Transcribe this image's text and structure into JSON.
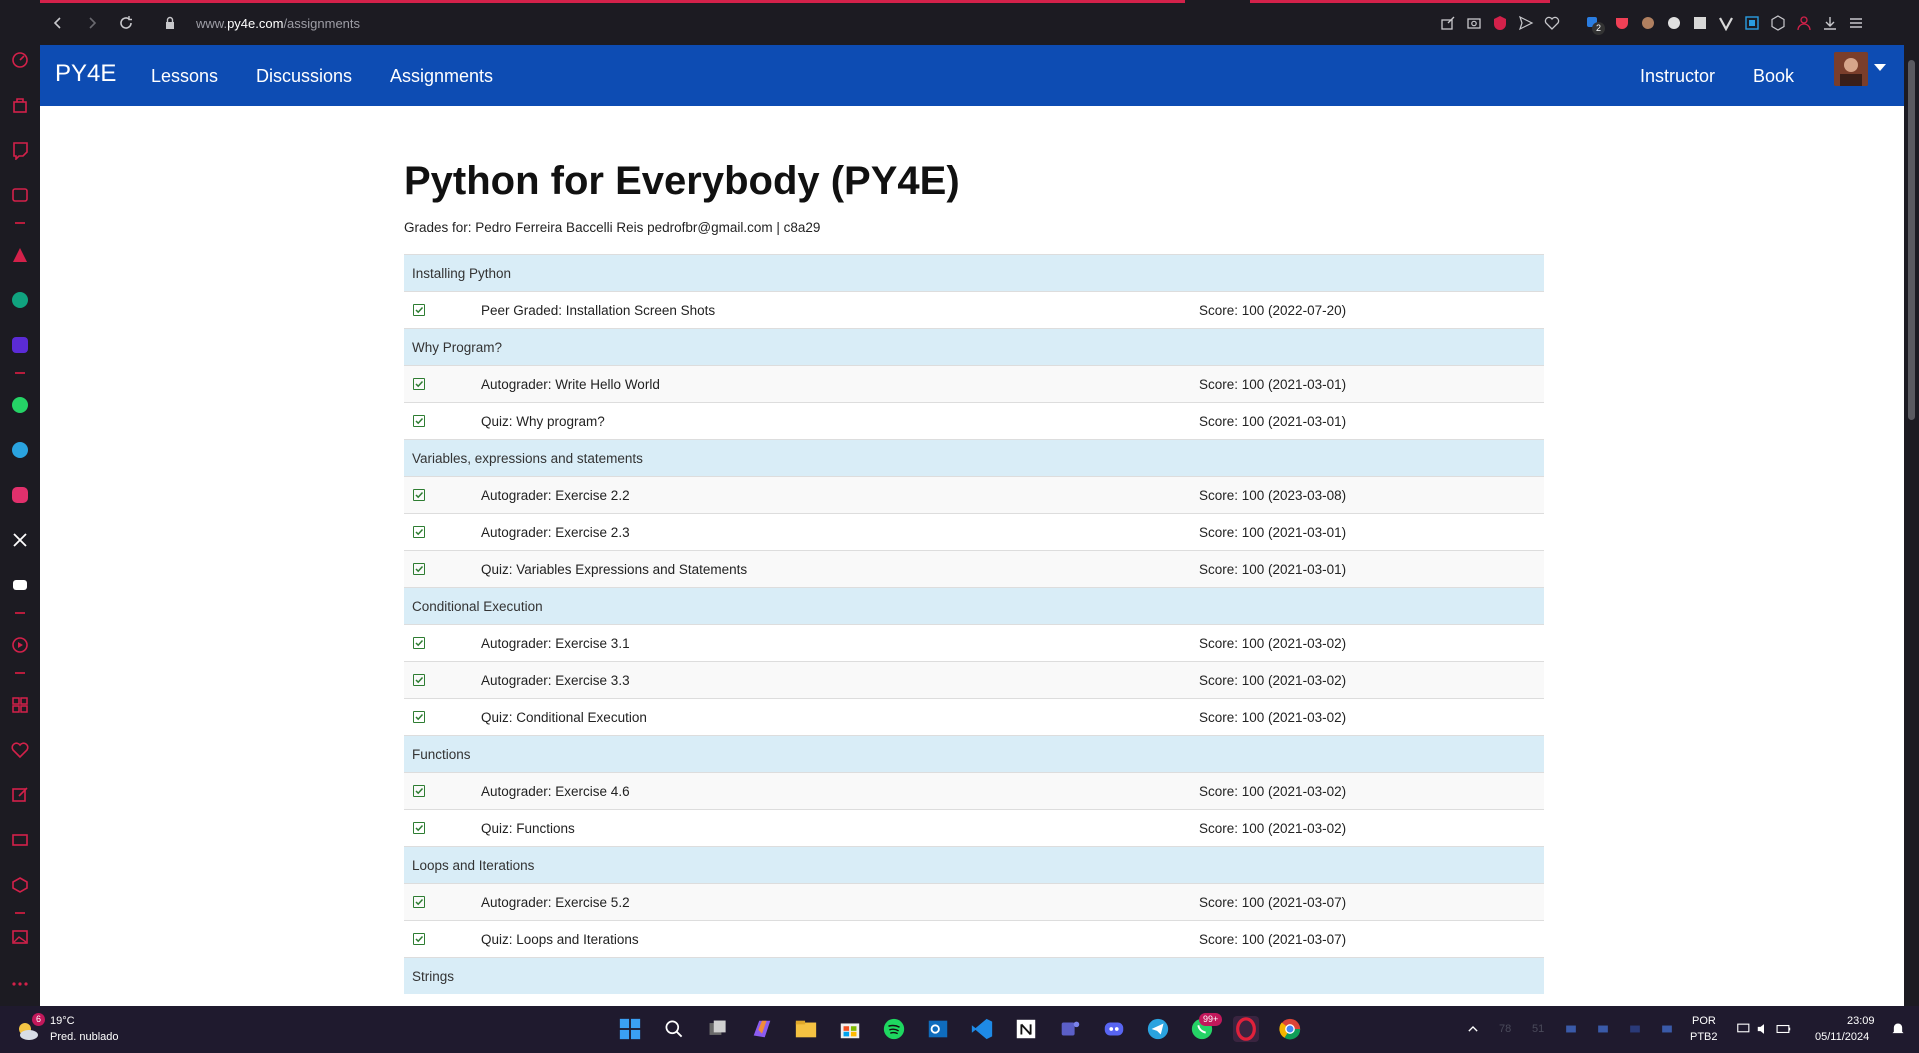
{
  "browser": {
    "url_prefix": "www.",
    "url_domain": "py4e.com",
    "url_path": "/assignments",
    "extension_badge": "2"
  },
  "site": {
    "brand": "PY4E",
    "nav_left": [
      "Lessons",
      "Discussions",
      "Assignments"
    ],
    "nav_right": [
      "Instructor",
      "Book"
    ]
  },
  "page": {
    "title": "Python for Everybody (PY4E)",
    "grades_for": "Grades for: Pedro Ferreira Baccelli Reis pedrofbr@gmail.com | c8a29"
  },
  "sections": [
    {
      "title": "Installing Python",
      "items": [
        {
          "title": "Peer Graded: Installation Screen Shots",
          "score": "Score: 100 (2022-07-20)",
          "done": true
        }
      ]
    },
    {
      "title": "Why Program?",
      "items": [
        {
          "title": "Autograder: Write Hello World",
          "score": "Score: 100 (2021-03-01)",
          "done": true
        },
        {
          "title": "Quiz: Why program?",
          "score": "Score: 100 (2021-03-01)",
          "done": true
        }
      ]
    },
    {
      "title": "Variables, expressions and statements",
      "items": [
        {
          "title": "Autograder: Exercise 2.2",
          "score": "Score: 100 (2023-03-08)",
          "done": true
        },
        {
          "title": "Autograder: Exercise 2.3",
          "score": "Score: 100 (2021-03-01)",
          "done": true
        },
        {
          "title": "Quiz: Variables Expressions and Statements",
          "score": "Score: 100 (2021-03-01)",
          "done": true
        }
      ]
    },
    {
      "title": "Conditional Execution",
      "items": [
        {
          "title": "Autograder: Exercise 3.1",
          "score": "Score: 100 (2021-03-02)",
          "done": true
        },
        {
          "title": "Autograder: Exercise 3.3",
          "score": "Score: 100 (2021-03-02)",
          "done": true
        },
        {
          "title": "Quiz: Conditional Execution",
          "score": "Score: 100 (2021-03-02)",
          "done": true
        }
      ]
    },
    {
      "title": "Functions",
      "items": [
        {
          "title": "Autograder: Exercise 4.6",
          "score": "Score: 100 (2021-03-02)",
          "done": true
        },
        {
          "title": "Quiz: Functions",
          "score": "Score: 100 (2021-03-02)",
          "done": true
        }
      ]
    },
    {
      "title": "Loops and Iterations",
      "items": [
        {
          "title": "Autograder: Exercise 5.2",
          "score": "Score: 100 (2021-03-07)",
          "done": true
        },
        {
          "title": "Quiz: Loops and Iterations",
          "score": "Score: 100 (2021-03-07)",
          "done": true
        }
      ]
    },
    {
      "title": "Strings",
      "items": []
    }
  ],
  "taskbar": {
    "weather_temp": "19°C",
    "weather_desc": "Pred. nublado",
    "weather_badge": "6",
    "whatsapp_badge": "99+",
    "language": "POR",
    "keyboard": "PTB2",
    "time": "23:09",
    "date": "05/11/2024",
    "tray_small_1": "78",
    "tray_small_2": "51"
  },
  "colors": {
    "navbar": "#0d4cb3",
    "section_row": "#d9edf7",
    "check": "#2e7d32",
    "browser_accent": "#d3214a"
  }
}
